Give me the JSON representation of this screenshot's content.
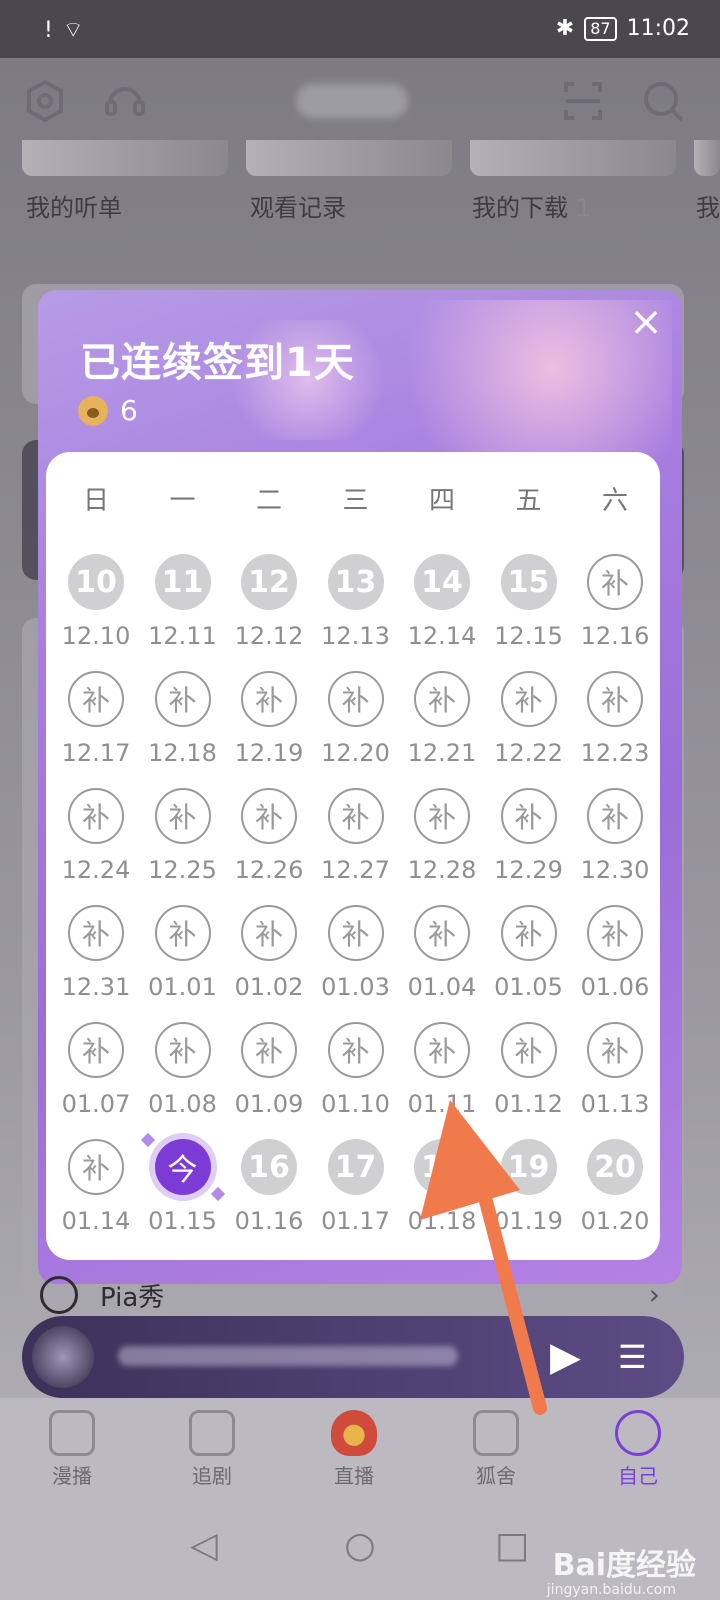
{
  "status_bar": {
    "time": "11:02",
    "battery": "87"
  },
  "shortcuts": [
    "我的听单",
    "观看记录",
    "我的下载",
    "我"
  ],
  "shortcut_counts": {
    "downloads": "1"
  },
  "modal": {
    "title": "已连续签到1天",
    "points": "6",
    "close_label": "×"
  },
  "calendar": {
    "weekdays": [
      "日",
      "一",
      "二",
      "三",
      "四",
      "五",
      "六"
    ],
    "cells": [
      {
        "label": "10",
        "date": "12.10",
        "state": "done"
      },
      {
        "label": "11",
        "date": "12.11",
        "state": "done"
      },
      {
        "label": "12",
        "date": "12.12",
        "state": "done"
      },
      {
        "label": "13",
        "date": "12.13",
        "state": "done"
      },
      {
        "label": "14",
        "date": "12.14",
        "state": "done"
      },
      {
        "label": "15",
        "date": "12.15",
        "state": "done"
      },
      {
        "label": "补",
        "date": "12.16",
        "state": "makeup"
      },
      {
        "label": "补",
        "date": "12.17",
        "state": "makeup"
      },
      {
        "label": "补",
        "date": "12.18",
        "state": "makeup"
      },
      {
        "label": "补",
        "date": "12.19",
        "state": "makeup"
      },
      {
        "label": "补",
        "date": "12.20",
        "state": "makeup"
      },
      {
        "label": "补",
        "date": "12.21",
        "state": "makeup"
      },
      {
        "label": "补",
        "date": "12.22",
        "state": "makeup"
      },
      {
        "label": "补",
        "date": "12.23",
        "state": "makeup"
      },
      {
        "label": "补",
        "date": "12.24",
        "state": "makeup"
      },
      {
        "label": "补",
        "date": "12.25",
        "state": "makeup"
      },
      {
        "label": "补",
        "date": "12.26",
        "state": "makeup"
      },
      {
        "label": "补",
        "date": "12.27",
        "state": "makeup"
      },
      {
        "label": "补",
        "date": "12.28",
        "state": "makeup"
      },
      {
        "label": "补",
        "date": "12.29",
        "state": "makeup"
      },
      {
        "label": "补",
        "date": "12.30",
        "state": "makeup"
      },
      {
        "label": "补",
        "date": "12.31",
        "state": "makeup"
      },
      {
        "label": "补",
        "date": "01.01",
        "state": "makeup"
      },
      {
        "label": "补",
        "date": "01.02",
        "state": "makeup"
      },
      {
        "label": "补",
        "date": "01.03",
        "state": "makeup"
      },
      {
        "label": "补",
        "date": "01.04",
        "state": "makeup"
      },
      {
        "label": "补",
        "date": "01.05",
        "state": "makeup"
      },
      {
        "label": "补",
        "date": "01.06",
        "state": "makeup"
      },
      {
        "label": "补",
        "date": "01.07",
        "state": "makeup"
      },
      {
        "label": "补",
        "date": "01.08",
        "state": "makeup"
      },
      {
        "label": "补",
        "date": "01.09",
        "state": "makeup"
      },
      {
        "label": "补",
        "date": "01.10",
        "state": "makeup"
      },
      {
        "label": "补",
        "date": "01.11",
        "state": "makeup"
      },
      {
        "label": "补",
        "date": "01.12",
        "state": "makeup"
      },
      {
        "label": "补",
        "date": "01.13",
        "state": "makeup"
      },
      {
        "label": "补",
        "date": "01.14",
        "state": "makeup"
      },
      {
        "label": "今",
        "date": "01.15",
        "state": "today"
      },
      {
        "label": "16",
        "date": "01.16",
        "state": "done"
      },
      {
        "label": "17",
        "date": "01.17",
        "state": "done"
      },
      {
        "label": "18",
        "date": "01.18",
        "state": "done"
      },
      {
        "label": "19",
        "date": "01.19",
        "state": "done"
      },
      {
        "label": "20",
        "date": "01.20",
        "state": "done"
      }
    ]
  },
  "pia": {
    "label": "Pia秀",
    "arrow": "›"
  },
  "tabs": [
    {
      "label": "漫播"
    },
    {
      "label": "追剧"
    },
    {
      "label": "直播"
    },
    {
      "label": "狐舍"
    },
    {
      "label": "自己"
    }
  ],
  "watermark": {
    "main": "Bai度经验",
    "sub": "jingyan.baidu.com"
  },
  "colors": {
    "accent": "#7d3bd6",
    "modal_bg": "#a77ee0",
    "arrow": "#f07a4b"
  }
}
